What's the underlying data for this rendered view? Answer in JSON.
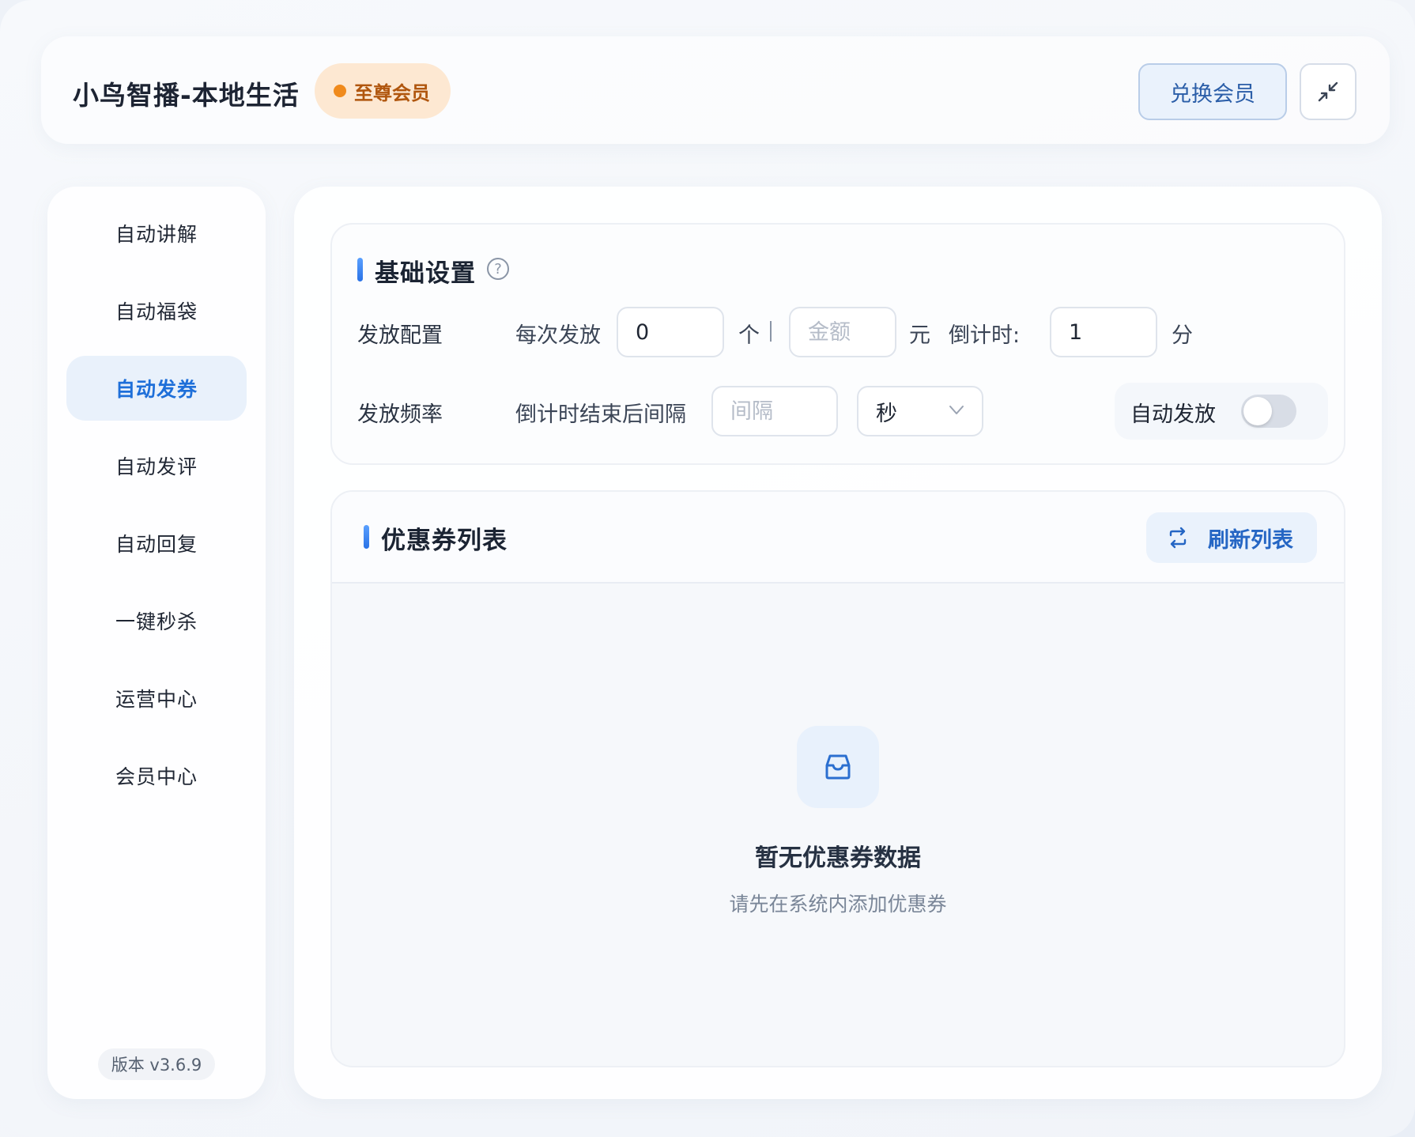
{
  "header": {
    "title": "小鸟智播-本地生活",
    "vip_label": "至尊会员",
    "redeem_label": "兑换会员",
    "shrink_icon": "shrink-icon"
  },
  "sidebar": {
    "items": [
      {
        "label": "自动讲解",
        "active": false
      },
      {
        "label": "自动福袋",
        "active": false
      },
      {
        "label": "自动发券",
        "active": true
      },
      {
        "label": "自动发评",
        "active": false
      },
      {
        "label": "自动回复",
        "active": false
      },
      {
        "label": "一键秒杀",
        "active": false
      },
      {
        "label": "运营中心",
        "active": false
      },
      {
        "label": "会员中心",
        "active": false
      }
    ],
    "version": "版本 v3.6.9"
  },
  "basic": {
    "title": "基础设置",
    "help_icon": "question-circle-icon",
    "dispatch_label": "发放配置",
    "per_time_label": "每次发放",
    "per_time_value": "0",
    "unit_piece": "个",
    "amount_placeholder": "金额",
    "unit_yuan": "元",
    "countdown_label": "倒计时:",
    "countdown_value": "1",
    "unit_minute": "分",
    "freq_label": "发放频率",
    "interval_label": "倒计时结束后间隔",
    "interval_placeholder": "间隔",
    "interval_unit": "秒",
    "auto_label": "自动发放",
    "auto_enabled": false
  },
  "coupons": {
    "title": "优惠券列表",
    "refresh_label": "刷新列表",
    "empty_title": "暂无优惠券数据",
    "empty_sub": "请先在系统内添加优惠券"
  },
  "colors": {
    "accent": "#1e6fd9",
    "vip_bg": "#fde8d2",
    "vip_dot": "#f08a1c"
  }
}
